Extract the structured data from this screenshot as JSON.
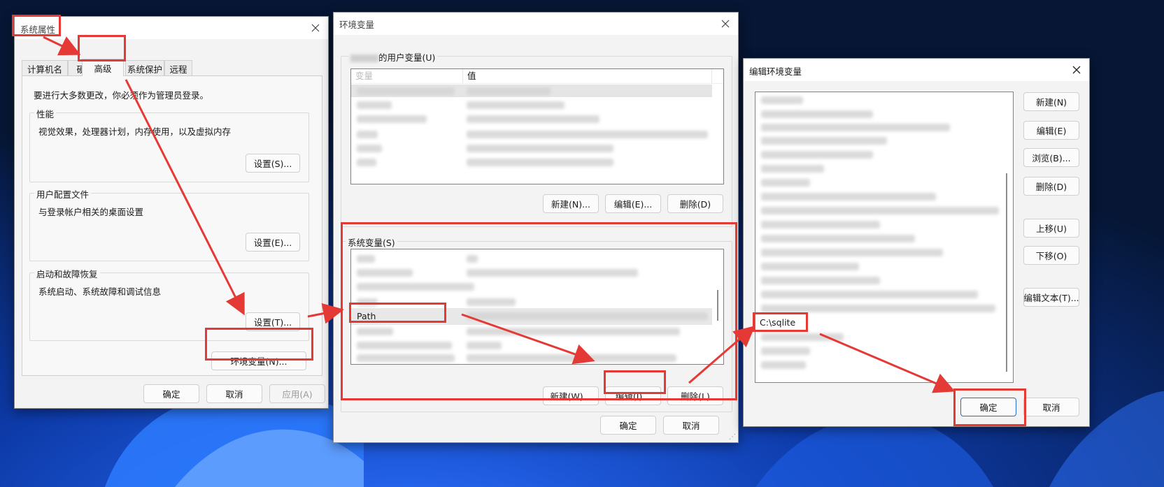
{
  "sys_props": {
    "title": "系统属性",
    "tabs": [
      "计算机名",
      "硬件",
      "高级",
      "系统保护",
      "远程"
    ],
    "admin_note": "要进行大多数更改，你必须作为管理员登录。",
    "performance": {
      "label": "性能",
      "desc": "视觉效果，处理器计划，内存使用，以及虚拟内存",
      "button": "设置(S)..."
    },
    "user_profile": {
      "label": "用户配置文件",
      "desc": "与登录帐户相关的桌面设置",
      "button": "设置(E)..."
    },
    "startup": {
      "label": "启动和故障恢复",
      "desc": "系统启动、系统故障和调试信息",
      "button": "设置(T)..."
    },
    "env_button": "环境变量(N)...",
    "ok": "确定",
    "cancel": "取消",
    "apply": "应用(A)"
  },
  "env_vars": {
    "title": "环境变量",
    "user_group_label": "的用户变量(U)",
    "col_name": "变量",
    "col_value": "值",
    "user_buttons": [
      "新建(N)...",
      "编辑(E)...",
      "删除(D)"
    ],
    "sys_group_label": "系统变量(S)",
    "selected_variable": "Path",
    "sys_buttons": [
      "新建(W)...",
      "编辑(I)...",
      "删除(L)"
    ],
    "ok": "确定",
    "cancel": "取消"
  },
  "edit_env": {
    "title": "编辑环境变量",
    "new_entry": "C:\\sqlite",
    "buttons": [
      "新建(N)",
      "编辑(E)",
      "浏览(B)...",
      "删除(D)",
      "上移(U)",
      "下移(O)",
      "编辑文本(T)..."
    ],
    "ok": "确定",
    "cancel": "取消"
  },
  "colors": {
    "highlight": "#e53935",
    "accent": "#1f6fd0",
    "dialog_bg": "#f3f3f3"
  }
}
